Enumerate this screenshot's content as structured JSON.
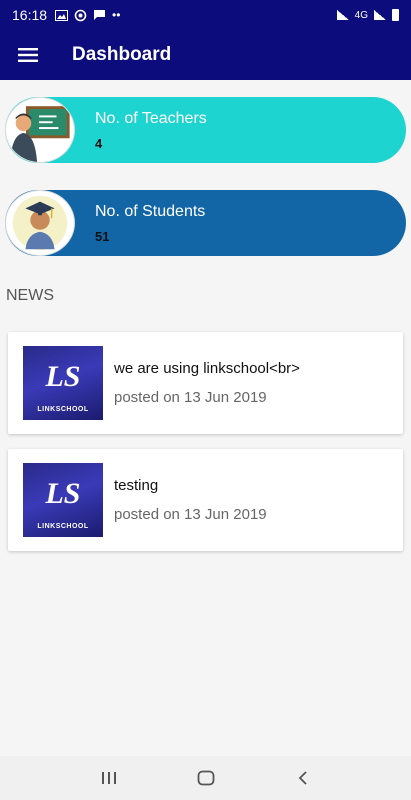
{
  "status_bar": {
    "time": "16:18",
    "network": "4G"
  },
  "app_bar": {
    "title": "Dashboard"
  },
  "stats": [
    {
      "label": "No. of Teachers",
      "value": "4"
    },
    {
      "label": "No. of Students",
      "value": "51"
    }
  ],
  "news": {
    "heading": "NEWS",
    "items": [
      {
        "title": "we are using linkschool<br>",
        "date": "posted on 13 Jun 2019",
        "thumb_brand": "LINKSCHOOL"
      },
      {
        "title": "testing",
        "date": "posted on 13 Jun 2019",
        "thumb_brand": "LINKSCHOOL"
      }
    ]
  },
  "colors": {
    "app_bar": "#0c0c7c",
    "teachers_card": "#1ed4d0",
    "students_card": "#1366a6"
  }
}
